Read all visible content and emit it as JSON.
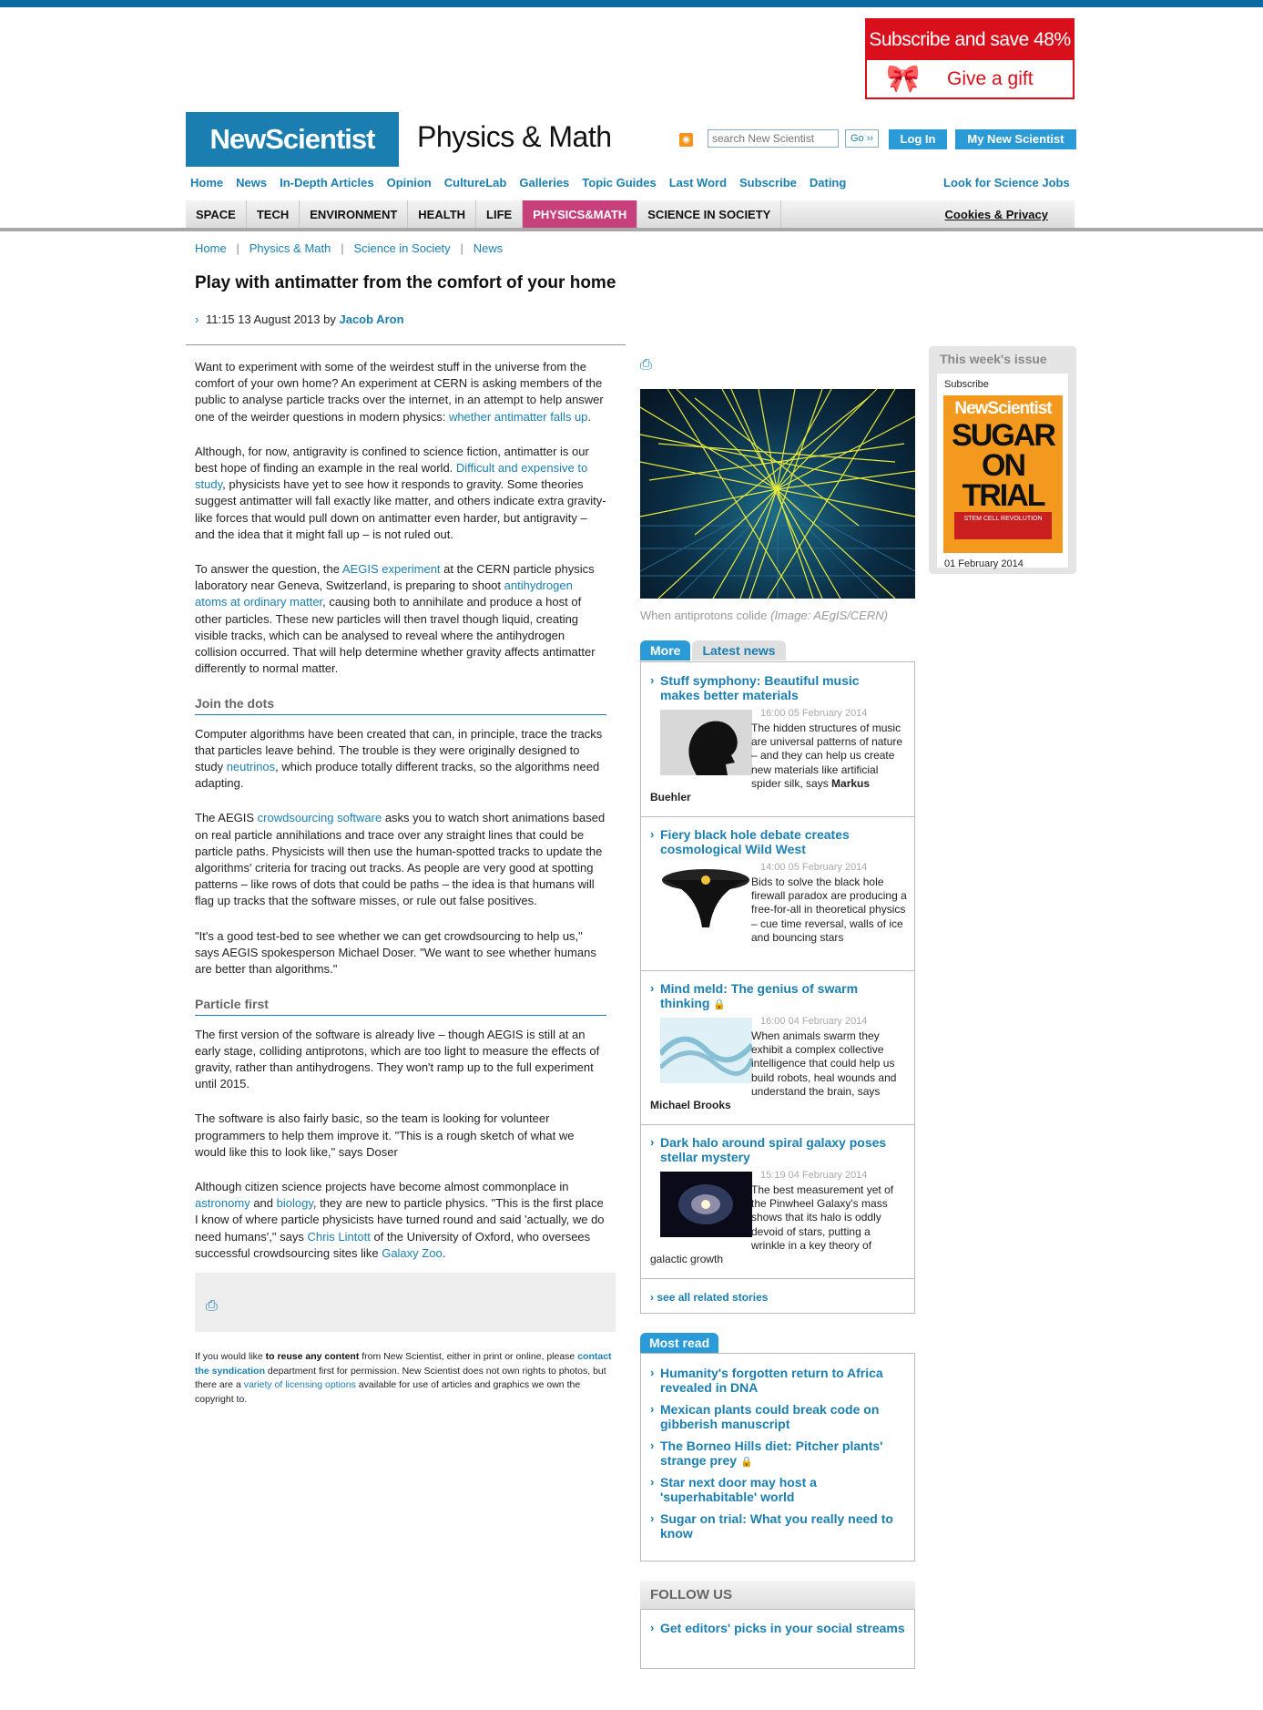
{
  "ad": {
    "subscribe_text": "Subscribe and save 48%",
    "gift_text": "Give a gift"
  },
  "header": {
    "logo": "NewScientist",
    "section_title": "Physics & Math",
    "search_placeholder": "search New Scientist",
    "go_label": "Go ››",
    "login_label": "Log In",
    "my_new_scientist_label": "My New Scientist"
  },
  "topnav": {
    "items": [
      "Home",
      "News",
      "In-Depth Articles",
      "Opinion",
      "CultureLab",
      "Galleries",
      "Topic Guides",
      "Last Word",
      "Subscribe",
      "Dating"
    ],
    "jobs": "Look for Science Jobs"
  },
  "secnav": {
    "items": [
      "SPACE",
      "TECH",
      "ENVIRONMENT",
      "HEALTH",
      "LIFE",
      "PHYSICS&MATH",
      "SCIENCE IN SOCIETY"
    ],
    "active": "PHYSICS&MATH",
    "cookies": "Cookies & Privacy"
  },
  "breadcrumb": [
    "Home",
    "Physics & Math",
    "Science in Society",
    "News"
  ],
  "article": {
    "headline": "Play with antimatter from the comfort of your home",
    "dateline": "11:15 13 August 2013 by",
    "author": "Jacob Aron",
    "p1_a": "Want to experiment with some of the weirdest stuff in the universe from the comfort of your own home? An experiment at CERN is asking members of the public to analyse particle tracks over the internet, in an attempt to help answer one of the weirder questions in modern physics: ",
    "p1_link": "whether antimatter falls up",
    "p1_b": ".",
    "p2_a": "Although, for now, antigravity is confined to science fiction, antimatter is our best hope of finding an example in the real world. ",
    "p2_link": "Difficult and expensive to study",
    "p2_b": ", physicists have yet to see how it responds to gravity. Some theories suggest antimatter will fall exactly like matter, and others indicate extra gravity-like forces that would pull down on antimatter even harder, but antigravity – and the idea that it might fall up – is not ruled out.",
    "p3_a": "To answer the question, the ",
    "p3_link1": "AEGIS experiment",
    "p3_b": " at the CERN particle physics laboratory near Geneva, Switzerland, is preparing to shoot ",
    "p3_link2": "antihydrogen atoms at ordinary matter",
    "p3_c": ", causing both to annihilate and produce a host of other particles. These new particles will then travel though liquid, creating visible tracks, which can be analysed to reveal where the antihydrogen collision occurred. That will help determine whether gravity affects antimatter differently to normal matter.",
    "h1": "Join the dots",
    "p4_a": "Computer algorithms have been created that can, in principle, trace the tracks that particles leave behind. The trouble is they were originally designed to study ",
    "p4_link": "neutrinos",
    "p4_b": ", which produce totally different tracks, so the algorithms need adapting.",
    "p5_a": "The AEGIS ",
    "p5_link": "crowdsourcing software",
    "p5_b": " asks you to watch short animations based on real particle annihilations and trace over any straight lines that could be particle paths. Physicists will then use the human-spotted tracks to update the algorithms' criteria for tracing out tracks. As people are very good at spotting patterns – like rows of dots that could be paths – the idea is that humans will flag up tracks that the software misses, or rule out false positives.",
    "p6": "\"It's a good test-bed to see whether we can get crowdsourcing to help us,\" says AEGIS spokesperson Michael Doser. \"We want to see whether humans are better than algorithms.\"",
    "h2": "Particle first",
    "p7": "The first version of the software is already live – though AEGIS is still at an early stage, colliding antiprotons, which are too light to measure the effects of gravity, rather than antihydrogens. They won't ramp up to the full experiment until 2015.",
    "p8": "The software is also fairly basic, so the team is looking for volunteer programmers to help them improve it. \"This is a rough sketch of what we would like this to look like,\" says Doser",
    "p9_a": "Although citizen science projects have become almost commonplace in ",
    "p9_link1": "astronomy",
    "p9_b": " and ",
    "p9_link2": "biology",
    "p9_c": ", they are new to particle physics. \"This is the first place I know of where particle physicists have turned round and said 'actually, we do need humans',\" says ",
    "p9_link3": "Chris Lintott",
    "p9_d": " of the University of Oxford, who oversees successful crowdsourcing sites like ",
    "p9_link4": "Galaxy Zoo",
    "p9_e": "."
  },
  "reuse": {
    "a": "If you would like ",
    "b": "to reuse any content",
    "c": " from New Scientist, either in print or online, please ",
    "d": "contact the syndication",
    "e": " department first for permission. New Scientist does not own rights to photos, but there are a ",
    "f": "variety of licensing options",
    "g": " available for use of articles and graphics we own the copyright to."
  },
  "image": {
    "caption": "When antiprotons colide",
    "credit": "(Image: AEgIS/CERN)"
  },
  "tabs": {
    "more": "More",
    "latest": "Latest news"
  },
  "news": [
    {
      "title": "Stuff symphony: Beautiful music makes better materials",
      "meta": "16:00 05 February 2014",
      "desc": "The hidden structures of music are universal patterns of nature – and they can help us create new materials like artificial spider silk, says ",
      "author": "Markus Buehler"
    },
    {
      "title": "Fiery black hole debate creates cosmological Wild West",
      "meta": "14:00 05 February 2014",
      "desc": "Bids to solve the black hole firewall paradox are producing a free-for-all in theoretical physics – cue time reversal, walls of ice and bouncing stars",
      "author": ""
    },
    {
      "title": "Mind meld: The genius of swarm thinking",
      "meta": "16:00 04 February 2014",
      "desc": "When animals swarm they exhibit a complex collective intelligence that could help us build robots, heal wounds and understand the brain, says ",
      "author": "Michael Brooks"
    },
    {
      "title": "Dark halo around spiral galaxy poses stellar mystery",
      "meta": "15:19 04 February 2014",
      "desc": "The best measurement yet of the Pinwheel Galaxy's mass shows that its halo is oddly devoid of stars, putting a wrinkle in a key theory of galactic growth",
      "author": ""
    }
  ],
  "see_all": "see all related stories",
  "most_read": {
    "label": "Most read",
    "items": [
      "Humanity's forgotten return to Africa revealed in DNA",
      "Mexican plants could break code on gibberish manuscript",
      "The Borneo Hills diet: Pitcher plants' strange prey",
      "Star next door may host a 'superhabitable' world",
      "Sugar on trial: What you really need to know"
    ]
  },
  "follow": {
    "label": "FOLLOW US",
    "link": "Get editors' picks in your social streams"
  },
  "issue": {
    "heading": "This week's issue",
    "subscribe": "Subscribe",
    "cover_logo": "NewScientist",
    "cover_title": "SUGAR ON TRIAL",
    "cover_band": "STEM CELL REVOLUTION",
    "date": "01 February 2014"
  }
}
